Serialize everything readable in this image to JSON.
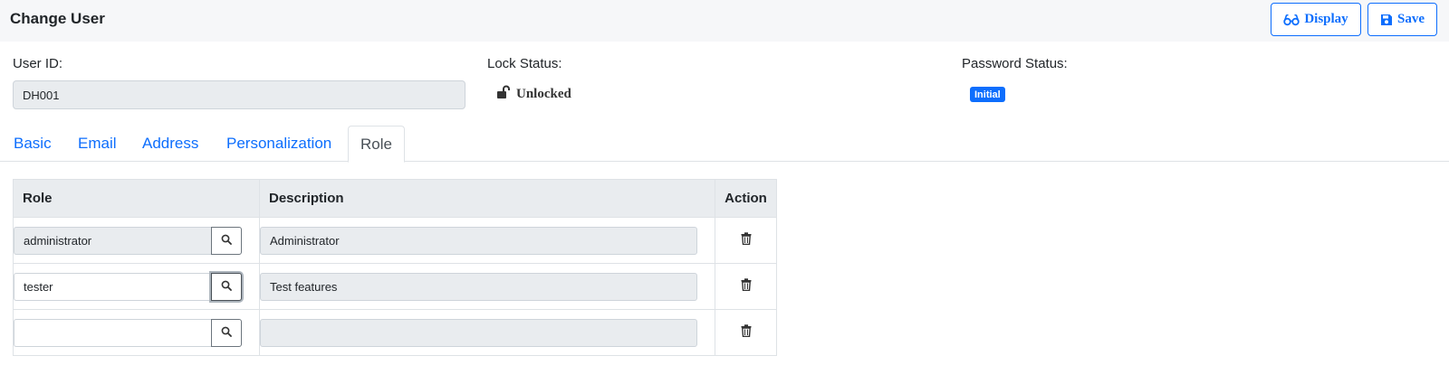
{
  "header": {
    "title": "Change User",
    "display_label": "Display",
    "save_label": "Save"
  },
  "fields": {
    "user_id_label": "User ID:",
    "user_id_value": "DH001",
    "lock_status_label": "Lock Status:",
    "lock_status_value": "Unlocked",
    "password_status_label": "Password Status:",
    "password_status_value": "Initial"
  },
  "tabs": [
    {
      "label": "Basic",
      "active": false
    },
    {
      "label": "Email",
      "active": false
    },
    {
      "label": "Address",
      "active": false
    },
    {
      "label": "Personalization",
      "active": false
    },
    {
      "label": "Role",
      "active": true
    }
  ],
  "table": {
    "headers": {
      "role": "Role",
      "description": "Description",
      "action": "Action"
    },
    "rows": [
      {
        "role": "administrator",
        "description": "Administrator"
      },
      {
        "role": "tester",
        "description": "Test features"
      },
      {
        "role": "",
        "description": ""
      }
    ]
  },
  "icons": {
    "display": "glasses-icon",
    "save": "floppy-disk-icon",
    "lock": "unlock-icon",
    "search": "search-icon",
    "delete": "trash-icon"
  },
  "colors": {
    "accent": "#0d6efd",
    "header_bg": "#f6f7f9",
    "readonly_bg": "#e9ecef"
  }
}
